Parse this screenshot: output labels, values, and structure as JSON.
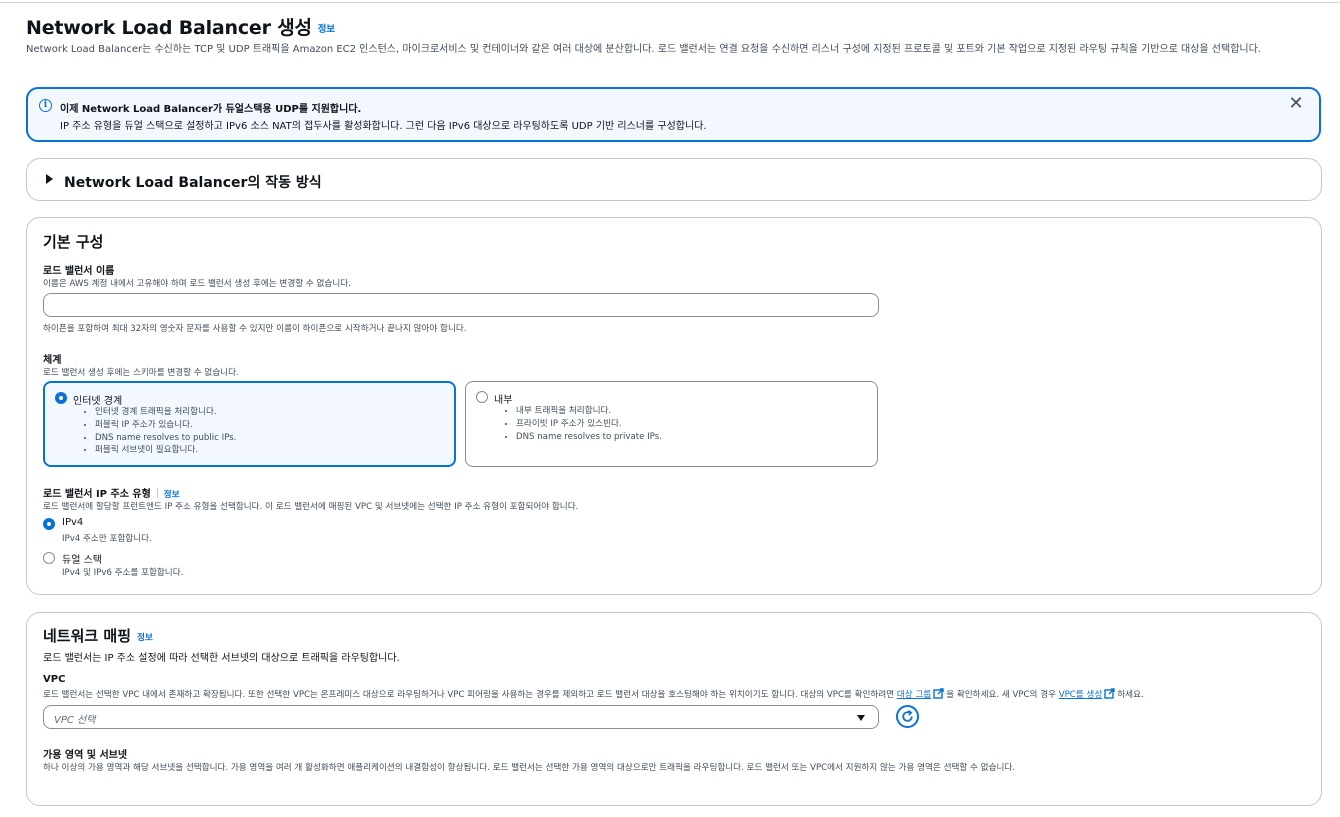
{
  "header": {
    "title": "Network Load Balancer 생성",
    "info_link": "정보",
    "description": "Network Load Balancer는 수신하는 TCP 및 UDP 트래픽을 Amazon EC2 인스턴스, 마이크로서비스 및 컨테이너와 같은 여러 대상에 분산합니다. 로드 밸런서는 연결 요청을 수신하면 리스너 구성에 지정된 프로토콜 및 포트와 기본 작업으로 지정된 라우팅 규칙을 기반으로 대상을 선택합니다."
  },
  "flash": {
    "title": "이제 Network Load Balancer가 듀얼스택용 UDP를 지원합니다.",
    "body": "IP 주소 유형을 듀얼 스택으로 설정하고 IPv6 소스 NAT의 접두사를 활성화합니다. 그런 다음 IPv6 대상으로 라우팅하도록 UDP 기반 리스너를 구성합니다.",
    "info_glyph": "i",
    "close_glyph": "✕"
  },
  "expander": {
    "title": "Network Load Balancer의 작동 방식"
  },
  "basic_config": {
    "title": "기본 구성",
    "name": {
      "label": "로드 밸런서 이름",
      "description": "이름은 AWS 계정 내에서 고유해야 하며 로드 밸런서 생성 후에는 변경할 수 없습니다.",
      "value": "",
      "constraint": "하이픈을 포함하여 최대 32자의 영숫자 문자를 사용할 수 있지만 이름이 하이픈으로 시작하거나 끝나지 않아야 합니다."
    },
    "scheme": {
      "label": "체계",
      "description": "로드 밸런서 생성 후에는 스키마를 변경할 수 없습니다.",
      "options": [
        {
          "label": "인터넷 경계",
          "selected": true,
          "bullets": [
            "인터넷 경계 트래픽을 처리합니다.",
            "퍼블릭 IP 주소가 있습니다.",
            "DNS name resolves to public IPs.",
            "퍼블릭 서브넷이 필요합니다."
          ]
        },
        {
          "label": "내부",
          "selected": false,
          "bullets": [
            "내부 트래픽을 처리합니다.",
            "프라이빗 IP 주소가 있스빈다.",
            "DNS name resolves to private IPs."
          ]
        }
      ]
    },
    "ip_type": {
      "label": "로드 밸런서 IP 주소 유형",
      "info_link": "정보",
      "description": "로드 밸런서에 할당할 프런트엔드 IP 주소 유형을 선택합니다. 이 로드 밸런서에 매핑된 VPC 및 서브넷에는 선택한 IP 주소 유형이 포함되어야 합니다.",
      "options": [
        {
          "label": "IPv4",
          "description": "IPv4 주소만 포함합니다.",
          "selected": true
        },
        {
          "label": "듀얼 스택",
          "description": "IPv4 및 IPv6 주소를 포함합니다.",
          "selected": false
        }
      ]
    }
  },
  "network_mapping": {
    "title": "네트워크 매핑",
    "info_link": "정보",
    "description": "로드 밸런서는 IP 주소 설정에 따라 선택한 서브넷의 대상으로 트래픽을 라우팅합니다.",
    "vpc": {
      "label": "VPC",
      "desc_before": "로드 밸런서는 선택한 VPC 내에서 존재하고 확장됩니다. 또한 선택한 VPC는 온프레미스 대상으로 라우팅하거나 VPC 피어링을 사용하는 경우를 제외하고 로드 밸런서 대상을 호스팅해야 하는 위치이기도 합니다. 대상의 VPC를 확인하려면 ",
      "link1": "대상 그룹",
      "desc_middle": "을 확인하세요. 새 VPC의 경우 ",
      "link2": "VPC를 생성",
      "desc_after": "하세요.",
      "placeholder": "VPC 선택"
    },
    "az": {
      "label": "가용 영역 및 서브넷",
      "description": "하나 이상의 가용 영역과 해당 서브넷을 선택합니다. 가용 영역을 여러 개 활성화하면 애플리케이션의 내결함성이 향상됩니다. 로드 밸런서는 선택한 가용 영역의 대상으로만 트래픽을 라우팅합니다. 로드 밸런서 또는 VPC에서 지원하지 않는 가용 영역은 선택할 수 없습니다."
    }
  },
  "colors": {
    "accent": "#0972d3",
    "info_bg": "#f2f8fd",
    "border": "#c6c6cd",
    "text": "#0f141a",
    "muted": "#414d5c"
  }
}
